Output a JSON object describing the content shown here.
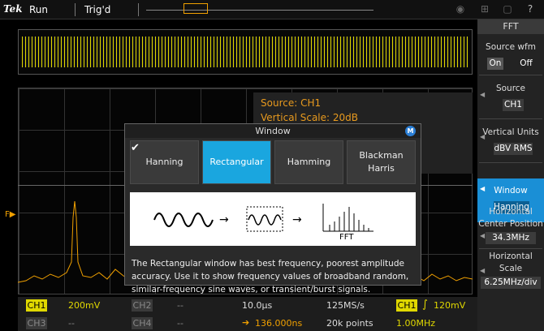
{
  "topbar": {
    "brand": "Tek",
    "run_state": "Run",
    "trig_state": "Trig'd"
  },
  "info": {
    "source": "Source: CH1",
    "vertical_scale": "Vertical Scale: 20dB"
  },
  "dialog": {
    "title": "Window",
    "m_badge": "M",
    "options": [
      {
        "label": "Hanning",
        "checked": true
      },
      {
        "label": "Rectangular",
        "selected": true
      },
      {
        "label": "Hamming"
      },
      {
        "label": "Blackman Harris"
      }
    ],
    "diagram_fft_label": "FFT",
    "description": "The Rectangular window has best frequency, poorest amplitude accuracy. Use it to show frequency values of broadband random, similar-frequency sine waves, or transient/burst signals."
  },
  "bottom": {
    "ch1": "CH1",
    "ch1_scale": "200mV",
    "ch2": "CH2",
    "ch2_scale": "--",
    "ch3": "CH3",
    "ch3_scale": "--",
    "ch4": "CH4",
    "ch4_scale": "--",
    "timebase": "10.0µs",
    "sample_rate": "125MS/s",
    "trig_source": "CH1",
    "trig_level": "120mV",
    "delay": "136.000ns",
    "record_length": "20k points",
    "frequency": "1.00MHz"
  },
  "menu": {
    "title": "FFT",
    "source_wfm_label": "Source wfm",
    "source_wfm_on": "On",
    "source_wfm_off": "Off",
    "source_label": "Source",
    "source_value": "CH1",
    "vertical_units_label": "Vertical Units",
    "vertical_units_value": "dBV RMS",
    "window_label": "Window",
    "window_value": "Hanning",
    "hcenter_label_1": "Horizontal",
    "hcenter_label_2": "Center Position",
    "hcenter_value": "34.3MHz",
    "hscale_label_1": "Horizontal",
    "hscale_label_2": "Scale",
    "hscale_value": "6.25MHz/div"
  },
  "colors": {
    "ch1": "#e0d800",
    "math": "#f0a000",
    "accent": "#1aa6df"
  }
}
